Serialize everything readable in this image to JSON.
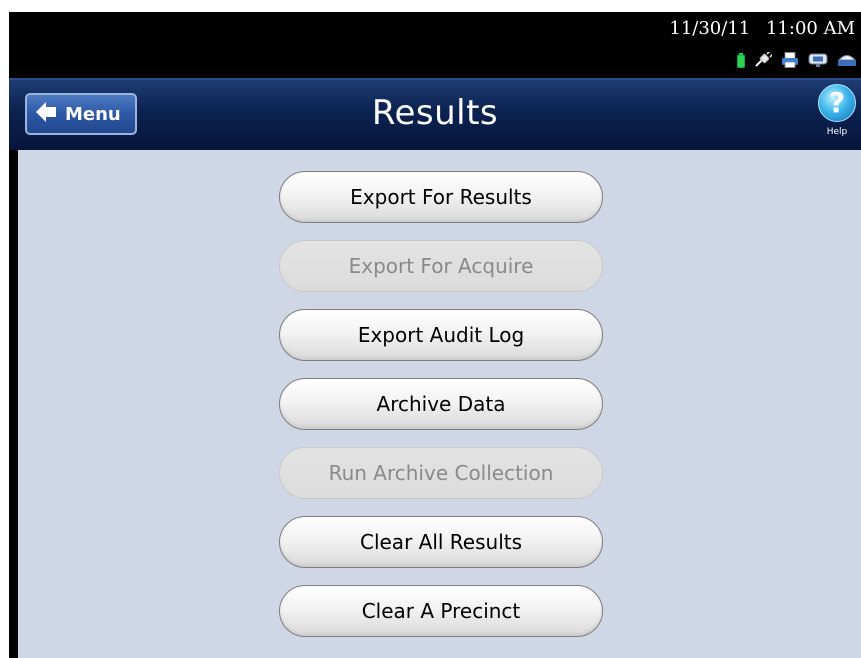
{
  "status": {
    "date": "11/30/11",
    "time": "11:00 AM",
    "icons": [
      "battery-icon",
      "power-plug-icon",
      "printer-icon",
      "network-icon",
      "media-icon"
    ]
  },
  "header": {
    "menu_label": "Menu",
    "title": "Results",
    "help_label": "Help",
    "help_glyph": "?"
  },
  "actions": [
    {
      "label": "Export For Results",
      "enabled": true
    },
    {
      "label": "Export For Acquire",
      "enabled": false
    },
    {
      "label": "Export Audit Log",
      "enabled": true
    },
    {
      "label": "Archive Data",
      "enabled": true
    },
    {
      "label": "Run Archive Collection",
      "enabled": false
    },
    {
      "label": "Clear All Results",
      "enabled": true
    },
    {
      "label": "Clear A Precinct",
      "enabled": true
    }
  ],
  "colors": {
    "header_bg": "#0b2250",
    "content_bg": "#cfd7e6",
    "menu_button": "#2d57a5",
    "help_icon": "#3db6ec",
    "battery": "#2fd14a"
  }
}
